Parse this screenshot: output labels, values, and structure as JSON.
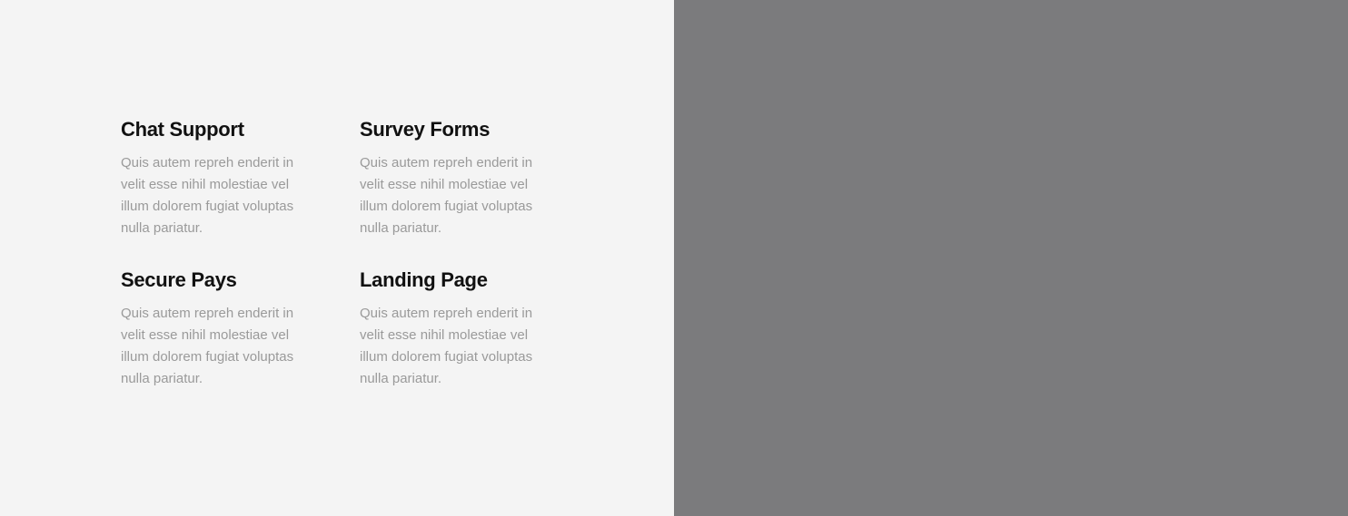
{
  "features": {
    "items": [
      {
        "title": "Chat Support",
        "description": "Quis autem repreh enderit in velit esse nihil molestiae vel illum dolorem fugiat voluptas nulla pariatur."
      },
      {
        "title": "Survey Forms",
        "description": "Quis autem repreh enderit in velit esse nihil molestiae vel illum dolorem fugiat voluptas nulla pariatur."
      },
      {
        "title": "Secure Pays",
        "description": "Quis autem repreh enderit in velit esse nihil molestiae vel illum dolorem fugiat voluptas nulla pariatur."
      },
      {
        "title": "Landing Page",
        "description": "Quis autem repreh enderit in velit esse nihil molestiae vel illum dolorem fugiat voluptas nulla pariatur."
      }
    ]
  },
  "colors": {
    "left_background": "#f4f4f4",
    "right_background": "#7b7b7d",
    "heading": "#111111",
    "body_text": "#9a9a9a"
  }
}
